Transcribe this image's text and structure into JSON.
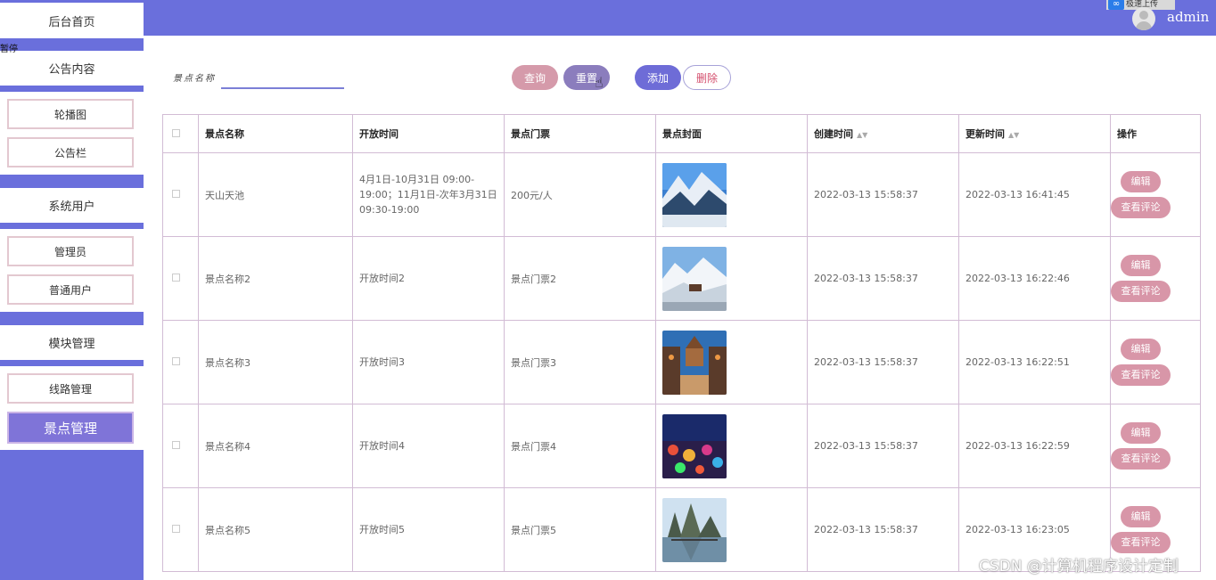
{
  "sidebar": {
    "home": "后台首页",
    "announce_group": "公告内容",
    "carousel": "轮播图",
    "bulletin": "公告栏",
    "users_group": "系统用户",
    "admin_user": "管理员",
    "normal_user": "普通用户",
    "module_group": "模块管理",
    "route_mgmt": "线路管理",
    "spot_mgmt": "景点管理"
  },
  "overlay": {
    "floating_label": "暂停",
    "top_tag": "极速上传"
  },
  "header": {
    "username": "admin"
  },
  "search": {
    "label": "景点名称",
    "value": ""
  },
  "toolbar": {
    "query": "查询",
    "reset": "重置",
    "add": "添加",
    "delete": "删除"
  },
  "table": {
    "headers": [
      "景点名称",
      "开放时间",
      "景点门票",
      "景点封面",
      "创建时间",
      "更新时间",
      "操作"
    ],
    "rows": [
      {
        "name": "天山天池",
        "open": "4月1日-10月31日 09:00-19:00；11月1日-次年3月31日 09:30-19:00",
        "ticket": "200元/人",
        "created": "2022-03-13 15:58:37",
        "updated": "2022-03-13 16:41:45",
        "img": "snow"
      },
      {
        "name": "景点名称2",
        "open": "开放时间2",
        "ticket": "景点门票2",
        "created": "2022-03-13 15:58:37",
        "updated": "2022-03-13 16:22:46",
        "img": "snow2"
      },
      {
        "name": "景点名称3",
        "open": "开放时间3",
        "ticket": "景点门票3",
        "created": "2022-03-13 15:58:37",
        "updated": "2022-03-13 16:22:51",
        "img": "town"
      },
      {
        "name": "景点名称4",
        "open": "开放时间4",
        "ticket": "景点门票4",
        "created": "2022-03-13 15:58:37",
        "updated": "2022-03-13 16:22:59",
        "img": "lantern"
      },
      {
        "name": "景点名称5",
        "open": "开放时间5",
        "ticket": "景点门票5",
        "created": "2022-03-13 15:58:37",
        "updated": "2022-03-13 16:23:05",
        "img": "lake"
      }
    ],
    "edit_label": "编辑",
    "comment_label": "查看评论"
  },
  "watermark": "CSDN @计算机程序设计定制"
}
